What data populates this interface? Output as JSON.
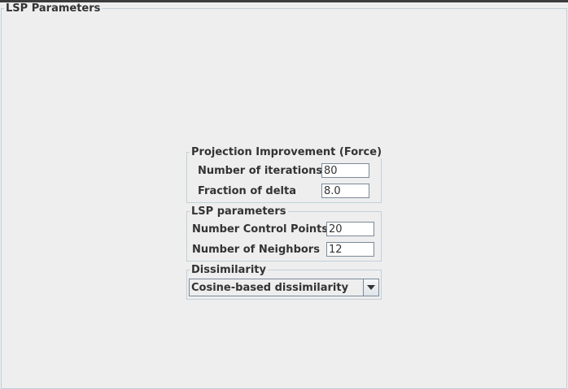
{
  "panel": {
    "title": "LSP Parameters"
  },
  "projection_improvement": {
    "title": "Projection Improvement (Force)",
    "iterations_label": "Number of iterations",
    "iterations_value": "80",
    "fraction_label": "Fraction of delta",
    "fraction_value": "8.0"
  },
  "lsp_parameters": {
    "title": "LSP parameters",
    "control_points_label": "Number Control Points",
    "control_points_value": "20",
    "neighbors_label": "Number of Neighbors",
    "neighbors_value": "12"
  },
  "dissimilarity": {
    "title": "Dissimilarity",
    "selected": "Cosine-based dissimilarity"
  }
}
